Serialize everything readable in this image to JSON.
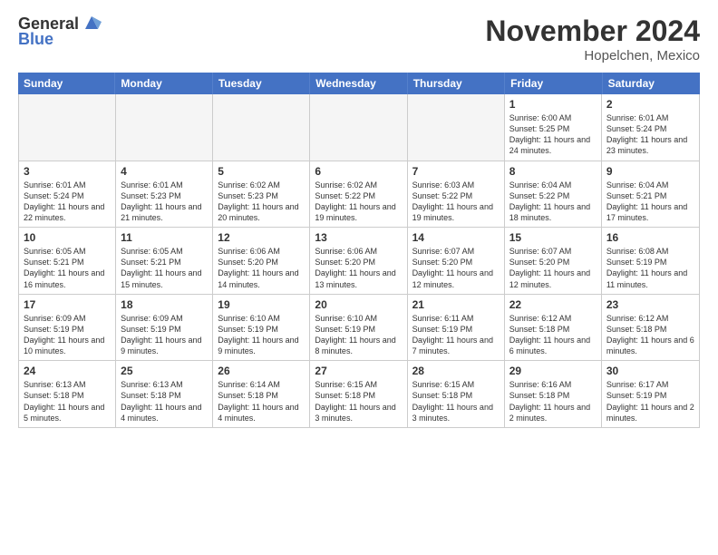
{
  "logo": {
    "general": "General",
    "blue": "Blue"
  },
  "title": "November 2024",
  "location": "Hopelchen, Mexico",
  "days_header": [
    "Sunday",
    "Monday",
    "Tuesday",
    "Wednesday",
    "Thursday",
    "Friday",
    "Saturday"
  ],
  "weeks": [
    [
      {
        "day": "",
        "info": "",
        "empty": true
      },
      {
        "day": "",
        "info": "",
        "empty": true
      },
      {
        "day": "",
        "info": "",
        "empty": true
      },
      {
        "day": "",
        "info": "",
        "empty": true
      },
      {
        "day": "",
        "info": "",
        "empty": true
      },
      {
        "day": "1",
        "info": "Sunrise: 6:00 AM\nSunset: 5:25 PM\nDaylight: 11 hours and 24 minutes.",
        "empty": false
      },
      {
        "day": "2",
        "info": "Sunrise: 6:01 AM\nSunset: 5:24 PM\nDaylight: 11 hours and 23 minutes.",
        "empty": false
      }
    ],
    [
      {
        "day": "3",
        "info": "Sunrise: 6:01 AM\nSunset: 5:24 PM\nDaylight: 11 hours and 22 minutes.",
        "empty": false
      },
      {
        "day": "4",
        "info": "Sunrise: 6:01 AM\nSunset: 5:23 PM\nDaylight: 11 hours and 21 minutes.",
        "empty": false
      },
      {
        "day": "5",
        "info": "Sunrise: 6:02 AM\nSunset: 5:23 PM\nDaylight: 11 hours and 20 minutes.",
        "empty": false
      },
      {
        "day": "6",
        "info": "Sunrise: 6:02 AM\nSunset: 5:22 PM\nDaylight: 11 hours and 19 minutes.",
        "empty": false
      },
      {
        "day": "7",
        "info": "Sunrise: 6:03 AM\nSunset: 5:22 PM\nDaylight: 11 hours and 19 minutes.",
        "empty": false
      },
      {
        "day": "8",
        "info": "Sunrise: 6:04 AM\nSunset: 5:22 PM\nDaylight: 11 hours and 18 minutes.",
        "empty": false
      },
      {
        "day": "9",
        "info": "Sunrise: 6:04 AM\nSunset: 5:21 PM\nDaylight: 11 hours and 17 minutes.",
        "empty": false
      }
    ],
    [
      {
        "day": "10",
        "info": "Sunrise: 6:05 AM\nSunset: 5:21 PM\nDaylight: 11 hours and 16 minutes.",
        "empty": false
      },
      {
        "day": "11",
        "info": "Sunrise: 6:05 AM\nSunset: 5:21 PM\nDaylight: 11 hours and 15 minutes.",
        "empty": false
      },
      {
        "day": "12",
        "info": "Sunrise: 6:06 AM\nSunset: 5:20 PM\nDaylight: 11 hours and 14 minutes.",
        "empty": false
      },
      {
        "day": "13",
        "info": "Sunrise: 6:06 AM\nSunset: 5:20 PM\nDaylight: 11 hours and 13 minutes.",
        "empty": false
      },
      {
        "day": "14",
        "info": "Sunrise: 6:07 AM\nSunset: 5:20 PM\nDaylight: 11 hours and 12 minutes.",
        "empty": false
      },
      {
        "day": "15",
        "info": "Sunrise: 6:07 AM\nSunset: 5:20 PM\nDaylight: 11 hours and 12 minutes.",
        "empty": false
      },
      {
        "day": "16",
        "info": "Sunrise: 6:08 AM\nSunset: 5:19 PM\nDaylight: 11 hours and 11 minutes.",
        "empty": false
      }
    ],
    [
      {
        "day": "17",
        "info": "Sunrise: 6:09 AM\nSunset: 5:19 PM\nDaylight: 11 hours and 10 minutes.",
        "empty": false
      },
      {
        "day": "18",
        "info": "Sunrise: 6:09 AM\nSunset: 5:19 PM\nDaylight: 11 hours and 9 minutes.",
        "empty": false
      },
      {
        "day": "19",
        "info": "Sunrise: 6:10 AM\nSunset: 5:19 PM\nDaylight: 11 hours and 9 minutes.",
        "empty": false
      },
      {
        "day": "20",
        "info": "Sunrise: 6:10 AM\nSunset: 5:19 PM\nDaylight: 11 hours and 8 minutes.",
        "empty": false
      },
      {
        "day": "21",
        "info": "Sunrise: 6:11 AM\nSunset: 5:19 PM\nDaylight: 11 hours and 7 minutes.",
        "empty": false
      },
      {
        "day": "22",
        "info": "Sunrise: 6:12 AM\nSunset: 5:18 PM\nDaylight: 11 hours and 6 minutes.",
        "empty": false
      },
      {
        "day": "23",
        "info": "Sunrise: 6:12 AM\nSunset: 5:18 PM\nDaylight: 11 hours and 6 minutes.",
        "empty": false
      }
    ],
    [
      {
        "day": "24",
        "info": "Sunrise: 6:13 AM\nSunset: 5:18 PM\nDaylight: 11 hours and 5 minutes.",
        "empty": false
      },
      {
        "day": "25",
        "info": "Sunrise: 6:13 AM\nSunset: 5:18 PM\nDaylight: 11 hours and 4 minutes.",
        "empty": false
      },
      {
        "day": "26",
        "info": "Sunrise: 6:14 AM\nSunset: 5:18 PM\nDaylight: 11 hours and 4 minutes.",
        "empty": false
      },
      {
        "day": "27",
        "info": "Sunrise: 6:15 AM\nSunset: 5:18 PM\nDaylight: 11 hours and 3 minutes.",
        "empty": false
      },
      {
        "day": "28",
        "info": "Sunrise: 6:15 AM\nSunset: 5:18 PM\nDaylight: 11 hours and 3 minutes.",
        "empty": false
      },
      {
        "day": "29",
        "info": "Sunrise: 6:16 AM\nSunset: 5:18 PM\nDaylight: 11 hours and 2 minutes.",
        "empty": false
      },
      {
        "day": "30",
        "info": "Sunrise: 6:17 AM\nSunset: 5:19 PM\nDaylight: 11 hours and 2 minutes.",
        "empty": false
      }
    ]
  ]
}
